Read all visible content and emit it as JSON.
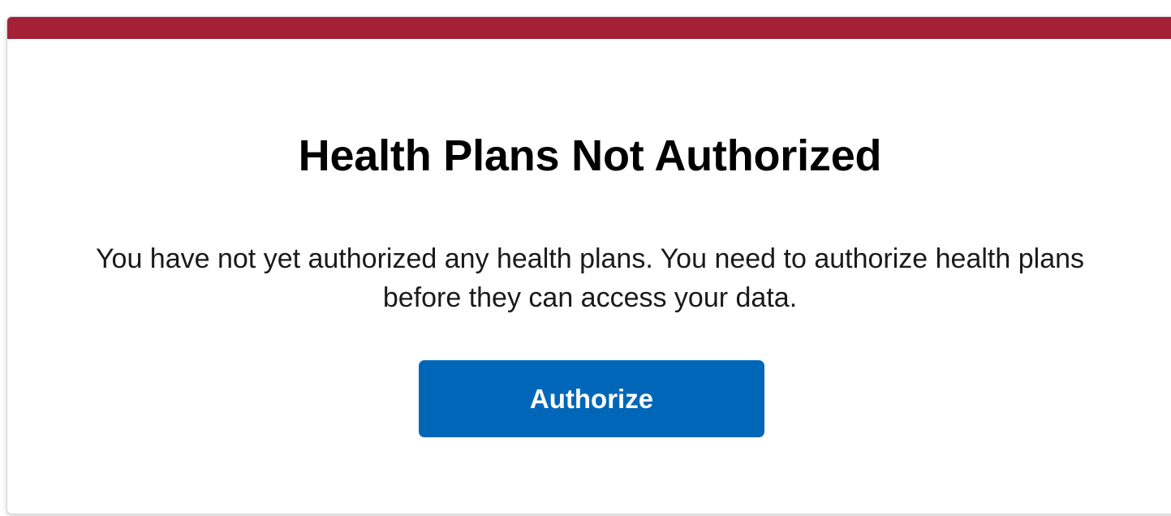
{
  "colors": {
    "accent_bar": "#a32035",
    "button_background": "#0067b8",
    "button_text": "#ffffff"
  },
  "dialog": {
    "title": "Health Plans Not Authorized",
    "message": "You have not yet authorized any health plans. You need to authorize health plans before they can access your data.",
    "authorize_label": "Authorize"
  }
}
